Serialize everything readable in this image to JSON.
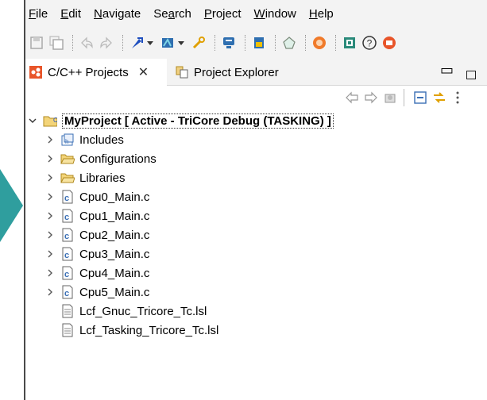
{
  "menubar": {
    "items": [
      {
        "label": "File",
        "mnemonic": "F",
        "rest": "ile"
      },
      {
        "label": "Edit",
        "mnemonic": "E",
        "rest": "dit"
      },
      {
        "label": "Navigate",
        "mnemonic": "N",
        "rest": "avigate"
      },
      {
        "label": "Search",
        "pre": "Se",
        "mnemonic": "a",
        "rest": "rch"
      },
      {
        "label": "Project",
        "mnemonic": "P",
        "rest": "roject"
      },
      {
        "label": "Window",
        "mnemonic": "W",
        "rest": "indow"
      },
      {
        "label": "Help",
        "mnemonic": "H",
        "rest": "elp"
      }
    ]
  },
  "toolbar": {
    "icons": [
      "save-icon",
      "save-all-icon",
      "undo-icon",
      "redo-icon",
      "build-icon",
      "debug-icon",
      "external-tools-icon",
      "console-icon",
      "memory-icon",
      "target-icon",
      "record-icon",
      "chip-icon",
      "help-icon",
      "plugin-icon"
    ]
  },
  "tabs": {
    "active": {
      "label": "C/C++ Projects",
      "close": "✕"
    },
    "inactive": {
      "label": "Project Explorer"
    }
  },
  "tree": {
    "root": {
      "label": "MyProject [ Active - TriCore Debug (TASKING) ]"
    },
    "items": [
      {
        "label": "Includes",
        "icon": "includes-icon",
        "expandable": true
      },
      {
        "label": "Configurations",
        "icon": "folder-icon",
        "expandable": true
      },
      {
        "label": "Libraries",
        "icon": "folder-icon",
        "expandable": true
      },
      {
        "label": "Cpu0_Main.c",
        "icon": "c-file-icon",
        "expandable": true
      },
      {
        "label": "Cpu1_Main.c",
        "icon": "c-file-icon",
        "expandable": true
      },
      {
        "label": "Cpu2_Main.c",
        "icon": "c-file-icon",
        "expandable": true
      },
      {
        "label": "Cpu3_Main.c",
        "icon": "c-file-icon",
        "expandable": true
      },
      {
        "label": "Cpu4_Main.c",
        "icon": "c-file-icon",
        "expandable": true
      },
      {
        "label": "Cpu5_Main.c",
        "icon": "c-file-icon",
        "expandable": true
      },
      {
        "label": "Lcf_Gnuc_Tricore_Tc.lsl",
        "icon": "text-file-icon",
        "expandable": false
      },
      {
        "label": "Lcf_Tasking_Tricore_Tc.lsl",
        "icon": "text-file-icon",
        "expandable": false
      }
    ]
  },
  "colors": {
    "accent_teal": "#2f9e9e",
    "folder": "#e8c24a",
    "c_file": "#3b6fb5"
  }
}
